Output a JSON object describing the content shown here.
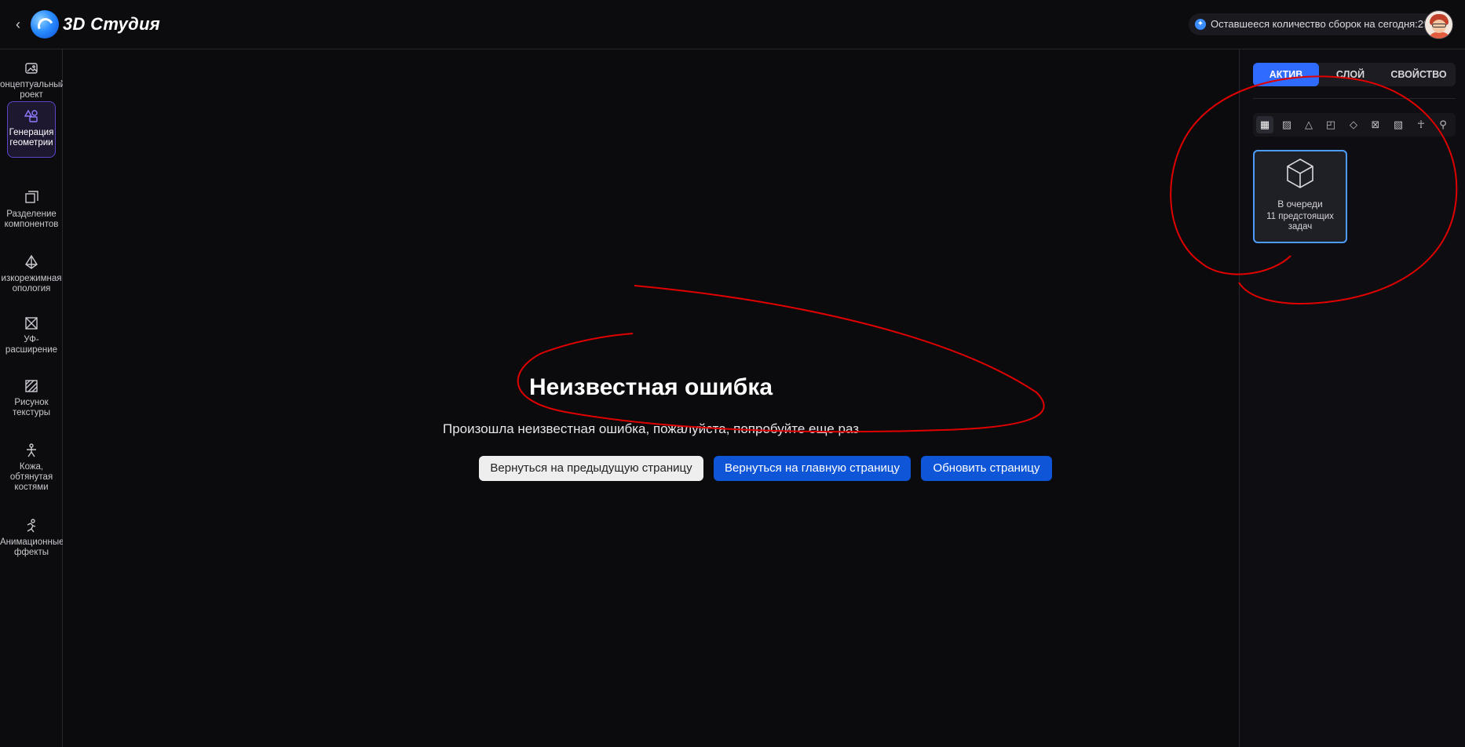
{
  "header": {
    "app_title": "3D Студия",
    "quota_text": "Оставшееся количество сборок на сегодня:29"
  },
  "sidebar": {
    "items": [
      {
        "label": "онцептуальный\nроект",
        "icon": "image-icon"
      },
      {
        "label": "Генерация\nгеометрии",
        "icon": "shapes-icon",
        "active": true
      },
      {
        "label": "Разделение\nкомпонентов",
        "icon": "split-icon"
      },
      {
        "label": "изкорежимная\nопология",
        "icon": "pyramid-icon"
      },
      {
        "label": "УФ-\nрасширение",
        "icon": "uv-icon"
      },
      {
        "label": "Рисунок\nтекстуры",
        "icon": "texture-icon"
      },
      {
        "label": "Кожа,\nобтянутая\nкостями",
        "icon": "skeleton-icon"
      },
      {
        "label": "Анимационные\nффекты",
        "icon": "running-icon"
      }
    ]
  },
  "main": {
    "error_title": "Неизвестная ошибка",
    "error_message": "Произошла неизвестная ошибка, пожалуйста, попробуйте еще раз",
    "buttons": {
      "prev": "Вернуться на предыдущую страницу",
      "home": "Вернуться на главную страницу",
      "refresh": "Обновить страницу"
    }
  },
  "right_panel": {
    "tabs": [
      "АКТИВ",
      "СЛОЙ",
      "СВОЙСТВО"
    ],
    "active_tab": "АКТИВ",
    "filter_icons": [
      "grid-icon",
      "image-icon",
      "shapes-icon",
      "split-icon",
      "pyramid-icon",
      "uv-icon",
      "texture-icon",
      "skeleton-icon",
      "running-icon"
    ],
    "card": {
      "status": "В очереди",
      "detail": "11 предстоящих задач"
    }
  },
  "colors": {
    "accent_blue": "#0e55d8",
    "tab_active": "#2f6bff",
    "sidebar_active_border": "#5a45c8",
    "card_border": "#4a9dff",
    "annotation_red": "#e00000"
  }
}
